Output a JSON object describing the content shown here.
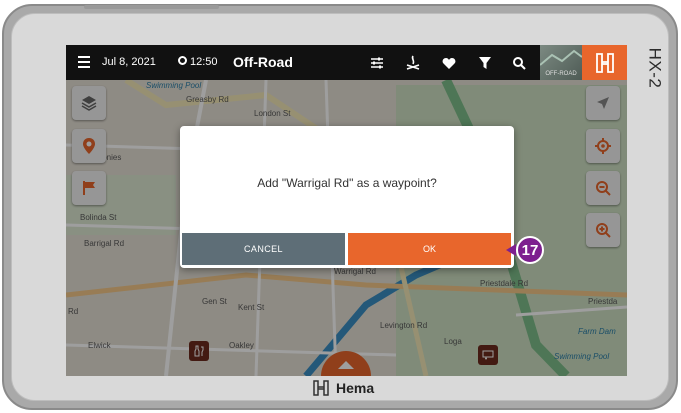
{
  "device": {
    "model": "HX-2",
    "brand": "Hema"
  },
  "topbar": {
    "date": "Jul 8, 2021",
    "time": "12:50",
    "mode": "Off-Road",
    "mode_thumb_label": "OFF-ROAD"
  },
  "map": {
    "labels": [
      "Swimming Pool",
      "Greasby Rd",
      "London St",
      "Devonies",
      "Bolinda St",
      "Warrigal Rd",
      "Barrigal Rd",
      "Priestdale Rd",
      "Priestda",
      "Farm Dam",
      "Swimming Pool",
      "Rd",
      "Oakley",
      "Levington Rd",
      "Loga",
      "Gen St",
      "Kent St",
      "Elwick"
    ]
  },
  "dialog": {
    "message": "Add \"Warrigal Rd\" as a waypoint?",
    "cancel_label": "CANCEL",
    "ok_label": "OK"
  },
  "annotation": {
    "step": "17"
  },
  "colors": {
    "accent": "#e8662c",
    "cancel": "#5e6e77",
    "badge": "#7d1f8f"
  }
}
